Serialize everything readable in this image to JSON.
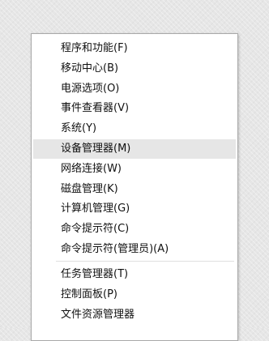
{
  "context_menu": {
    "items": [
      {
        "label": "程序和功能(F)"
      },
      {
        "label": "移动中心(B)"
      },
      {
        "label": "电源选项(O)"
      },
      {
        "label": "事件查看器(V)"
      },
      {
        "label": "系统(Y)"
      },
      {
        "label": "设备管理器(M)",
        "highlighted": true
      },
      {
        "label": "网络连接(W)"
      },
      {
        "label": "磁盘管理(K)"
      },
      {
        "label": "计算机管理(G)"
      },
      {
        "label": "命令提示符(C)"
      },
      {
        "label": "命令提示符(管理员)(A)"
      },
      {
        "label": "任务管理器(T)"
      },
      {
        "label": "控制面板(P)"
      },
      {
        "label": "文件资源管理器"
      }
    ]
  }
}
